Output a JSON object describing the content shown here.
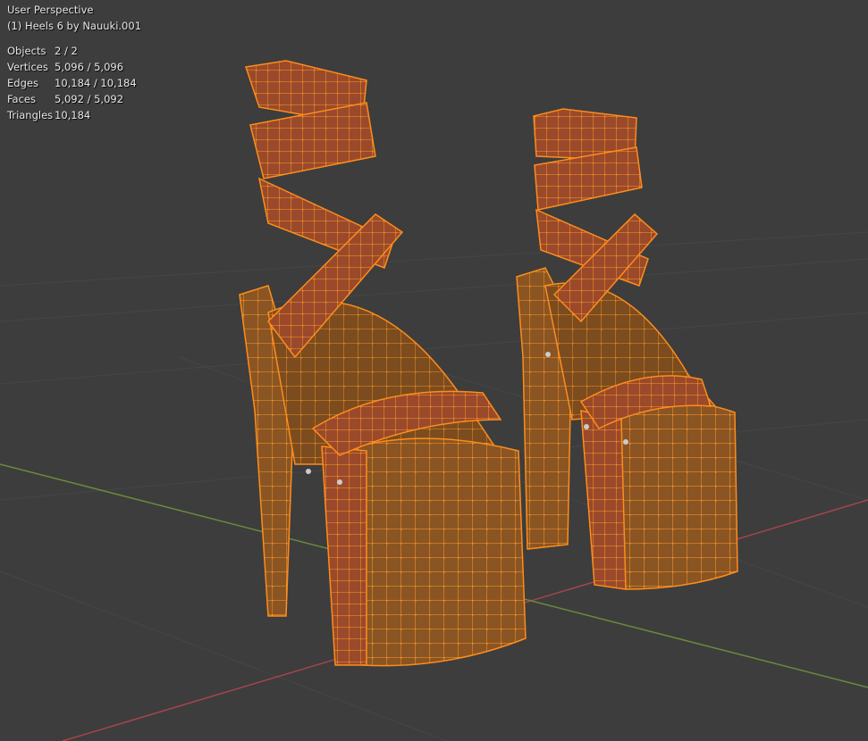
{
  "viewport": {
    "view_name": "User Perspective",
    "object_name": "(1) Heels 6 by Nauuki.001",
    "background": "#3d3d3d",
    "grid_color": "#484848",
    "x_axis_color": "#a6444c",
    "y_axis_color": "#6a8a3b",
    "selection_color": "#ff8c1a",
    "mesh_fill": "#8a5522"
  },
  "stats": [
    {
      "label": "Objects",
      "value": "2 / 2"
    },
    {
      "label": "Vertices",
      "value": "5,096 / 5,096"
    },
    {
      "label": "Edges",
      "value": "10,184 / 10,184"
    },
    {
      "label": "Faces",
      "value": "5,092 / 5,092"
    },
    {
      "label": "Triangles",
      "value": "10,184"
    }
  ]
}
